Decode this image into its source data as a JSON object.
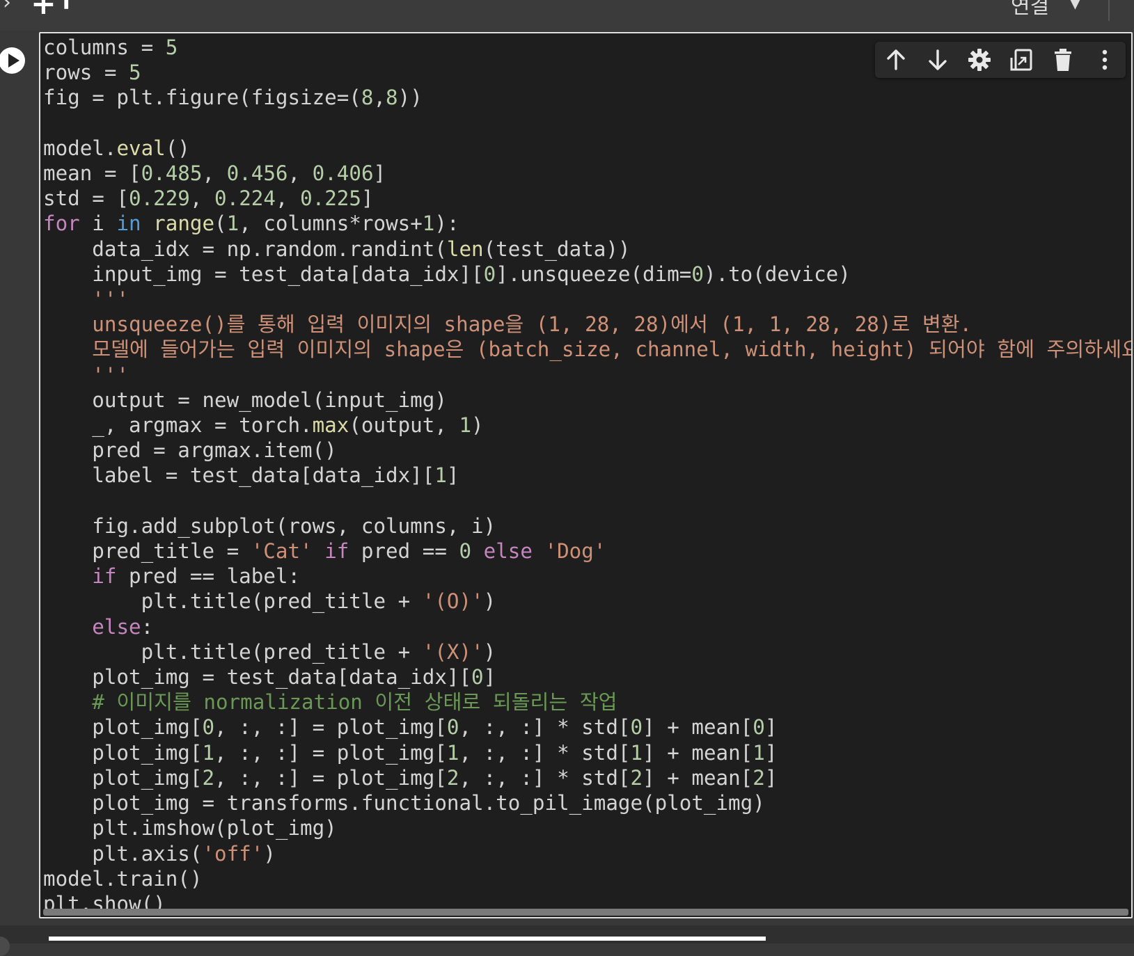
{
  "topbar": {
    "connect_label": "연결"
  },
  "code_lines": [
    [
      {
        "t": "columns = "
      },
      {
        "t": "5",
        "c": "num"
      }
    ],
    [
      {
        "t": "rows = "
      },
      {
        "t": "5",
        "c": "num"
      }
    ],
    [
      {
        "t": "fig = plt.figure(figsize=("
      },
      {
        "t": "8",
        "c": "num"
      },
      {
        "t": ","
      },
      {
        "t": "8",
        "c": "num"
      },
      {
        "t": "))"
      }
    ],
    [],
    [
      {
        "t": "model."
      },
      {
        "t": "eval",
        "c": "fn"
      },
      {
        "t": "()"
      }
    ],
    [
      {
        "t": "mean = ["
      },
      {
        "t": "0.485",
        "c": "num"
      },
      {
        "t": ", "
      },
      {
        "t": "0.456",
        "c": "num"
      },
      {
        "t": ", "
      },
      {
        "t": "0.406",
        "c": "num"
      },
      {
        "t": "]"
      }
    ],
    [
      {
        "t": "std = ["
      },
      {
        "t": "0.229",
        "c": "num"
      },
      {
        "t": ", "
      },
      {
        "t": "0.224",
        "c": "num"
      },
      {
        "t": ", "
      },
      {
        "t": "0.225",
        "c": "num"
      },
      {
        "t": "]"
      }
    ],
    [
      {
        "t": "for",
        "c": "kw"
      },
      {
        "t": " i "
      },
      {
        "t": "in",
        "c": "kb"
      },
      {
        "t": " "
      },
      {
        "t": "range",
        "c": "fn"
      },
      {
        "t": "("
      },
      {
        "t": "1",
        "c": "num"
      },
      {
        "t": ", columns*rows+"
      },
      {
        "t": "1",
        "c": "num"
      },
      {
        "t": "):"
      }
    ],
    [
      {
        "t": "    data_idx = np.random.randint("
      },
      {
        "t": "len",
        "c": "fn"
      },
      {
        "t": "(test_data))"
      }
    ],
    [
      {
        "t": "    input_img = test_data[data_idx]["
      },
      {
        "t": "0",
        "c": "num"
      },
      {
        "t": "].unsqueeze(dim="
      },
      {
        "t": "0",
        "c": "num"
      },
      {
        "t": ").to(device)"
      }
    ],
    [
      {
        "t": "    '''",
        "c": "str"
      }
    ],
    [
      {
        "t": "    unsqueeze()를 통해 입력 이미지의 shape을 (1, 28, 28)에서 (1, 1, 28, 28)로 변환.",
        "c": "str"
      }
    ],
    [
      {
        "t": "    모델에 들어가는 입력 이미지의 shape은 (batch_size, channel, width, height) 되어야 함에 주의하세요",
        "c": "str"
      }
    ],
    [
      {
        "t": "    '''",
        "c": "str"
      }
    ],
    [
      {
        "t": "    output = new_model(input_img)"
      }
    ],
    [
      {
        "t": "    _, argmax = torch."
      },
      {
        "t": "max",
        "c": "fn"
      },
      {
        "t": "(output, "
      },
      {
        "t": "1",
        "c": "num"
      },
      {
        "t": ")"
      }
    ],
    [
      {
        "t": "    pred = argmax.item()"
      }
    ],
    [
      {
        "t": "    label = test_data[data_idx]["
      },
      {
        "t": "1",
        "c": "num"
      },
      {
        "t": "]"
      }
    ],
    [],
    [
      {
        "t": "    fig.add_subplot(rows, columns, i)"
      }
    ],
    [
      {
        "t": "    pred_title = "
      },
      {
        "t": "'Cat'",
        "c": "str"
      },
      {
        "t": " "
      },
      {
        "t": "if",
        "c": "kw"
      },
      {
        "t": " pred == "
      },
      {
        "t": "0",
        "c": "num"
      },
      {
        "t": " "
      },
      {
        "t": "else",
        "c": "kw"
      },
      {
        "t": " "
      },
      {
        "t": "'Dog'",
        "c": "str"
      }
    ],
    [
      {
        "t": "    "
      },
      {
        "t": "if",
        "c": "kw"
      },
      {
        "t": " pred == label:"
      }
    ],
    [
      {
        "t": "        plt.title(pred_title + "
      },
      {
        "t": "'(O)'",
        "c": "str"
      },
      {
        "t": ")"
      }
    ],
    [
      {
        "t": "    "
      },
      {
        "t": "else",
        "c": "kw"
      },
      {
        "t": ":"
      }
    ],
    [
      {
        "t": "        plt.title(pred_title + "
      },
      {
        "t": "'(X)'",
        "c": "str"
      },
      {
        "t": ")"
      }
    ],
    [
      {
        "t": "    plot_img = test_data[data_idx]["
      },
      {
        "t": "0",
        "c": "num"
      },
      {
        "t": "]"
      }
    ],
    [
      {
        "t": "    # 이미지를 normalization 이전 상태로 되돌리는 작업",
        "c": "com"
      }
    ],
    [
      {
        "t": "    plot_img["
      },
      {
        "t": "0",
        "c": "num"
      },
      {
        "t": ", :, :] = plot_img["
      },
      {
        "t": "0",
        "c": "num"
      },
      {
        "t": ", :, :] * std["
      },
      {
        "t": "0",
        "c": "num"
      },
      {
        "t": "] + mean["
      },
      {
        "t": "0",
        "c": "num"
      },
      {
        "t": "]"
      }
    ],
    [
      {
        "t": "    plot_img["
      },
      {
        "t": "1",
        "c": "num"
      },
      {
        "t": ", :, :] = plot_img["
      },
      {
        "t": "1",
        "c": "num"
      },
      {
        "t": ", :, :] * std["
      },
      {
        "t": "1",
        "c": "num"
      },
      {
        "t": "] + mean["
      },
      {
        "t": "1",
        "c": "num"
      },
      {
        "t": "]"
      }
    ],
    [
      {
        "t": "    plot_img["
      },
      {
        "t": "2",
        "c": "num"
      },
      {
        "t": ", :, :] = plot_img["
      },
      {
        "t": "2",
        "c": "num"
      },
      {
        "t": ", :, :] * std["
      },
      {
        "t": "2",
        "c": "num"
      },
      {
        "t": "] + mean["
      },
      {
        "t": "2",
        "c": "num"
      },
      {
        "t": "]"
      }
    ],
    [
      {
        "t": "    plot_img = transforms.functional.to_pil_image(plot_img)"
      }
    ],
    [
      {
        "t": "    plt.imshow(plot_img)"
      }
    ],
    [
      {
        "t": "    plt.axis("
      },
      {
        "t": "'off'",
        "c": "str"
      },
      {
        "t": ")"
      }
    ],
    [
      {
        "t": "model.train()"
      }
    ],
    [
      {
        "t": "plt.show()"
      }
    ]
  ],
  "cell_toolbar": [
    {
      "name": "move-up-icon"
    },
    {
      "name": "move-down-icon"
    },
    {
      "name": "settings-gear-icon"
    },
    {
      "name": "mirror-cell-icon"
    },
    {
      "name": "delete-trash-icon"
    },
    {
      "name": "more-options-icon"
    }
  ],
  "colors": {
    "background": "#1e1e1e",
    "text": "#d4d4d4",
    "keyword": "#c586c0",
    "builtin_keyword": "#569cd6",
    "function": "#dcdcaa",
    "number": "#b5cea8",
    "string": "#ce9178",
    "comment": "#6a9955"
  }
}
